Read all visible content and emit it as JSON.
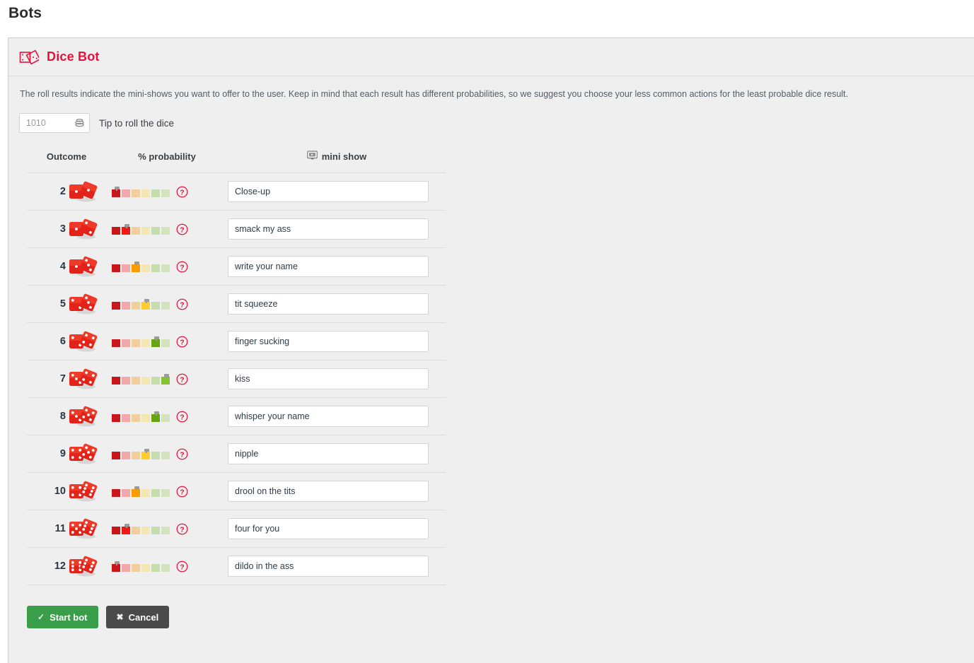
{
  "page": {
    "title": "Bots"
  },
  "panel": {
    "title": "Dice Bot",
    "icon": "dice-outline-icon",
    "description": "The roll results indicate the mini-shows you want to offer to the user. Keep in mind that each result has different probabilities, so we suggest you choose your less common actions for the least probable dice result."
  },
  "tip": {
    "value": "1010",
    "placeholder": "1010",
    "icon": "token-stack-icon",
    "label": "Tip to roll the dice"
  },
  "table": {
    "headers": {
      "outcome": "Outcome",
      "probability": "% probability",
      "mini_show": "mini show",
      "mini_show_icon": "monitor-play-icon"
    },
    "help_icon": "question-circle-icon",
    "segment_colors": [
      "#c8161a",
      "#f0a8a8",
      "#f2ce9b",
      "#f5e7b4",
      "#c5dcae",
      "#d3e3bd"
    ],
    "active_colors": [
      "#c8161a",
      "#ee1b14",
      "#fc9c00",
      "#ffcd2e",
      "#66a411",
      "#84c234"
    ],
    "rows": [
      {
        "outcome": "2",
        "dice": [
          1,
          1
        ],
        "segment": 1,
        "mini_show": "Close-up"
      },
      {
        "outcome": "3",
        "dice": [
          1,
          2
        ],
        "segment": 2,
        "mini_show": "smack my ass"
      },
      {
        "outcome": "4",
        "dice": [
          1,
          3
        ],
        "segment": 3,
        "mini_show": "write your name"
      },
      {
        "outcome": "5",
        "dice": [
          2,
          3
        ],
        "segment": 4,
        "mini_show": "tit squeeze"
      },
      {
        "outcome": "6",
        "dice": [
          2,
          4
        ],
        "segment": 5,
        "mini_show": "finger sucking"
      },
      {
        "outcome": "7",
        "dice": [
          3,
          4
        ],
        "segment": 6,
        "mini_show": "kiss"
      },
      {
        "outcome": "8",
        "dice": [
          3,
          5
        ],
        "segment": 5,
        "mini_show": "whisper your name"
      },
      {
        "outcome": "9",
        "dice": [
          4,
          5
        ],
        "segment": 4,
        "mini_show": "nipple"
      },
      {
        "outcome": "10",
        "dice": [
          4,
          6
        ],
        "segment": 3,
        "mini_show": "drool on the tits"
      },
      {
        "outcome": "11",
        "dice": [
          5,
          6
        ],
        "segment": 2,
        "mini_show": "four for you"
      },
      {
        "outcome": "12",
        "dice": [
          6,
          6
        ],
        "segment": 1,
        "mini_show": "dildo in the ass"
      }
    ]
  },
  "footer": {
    "start_label": "Start bot",
    "start_icon": "check-icon",
    "start_color": "#3a9d4a",
    "cancel_label": "Cancel",
    "cancel_icon": "cross-icon",
    "cancel_color": "#4a4a4a"
  }
}
